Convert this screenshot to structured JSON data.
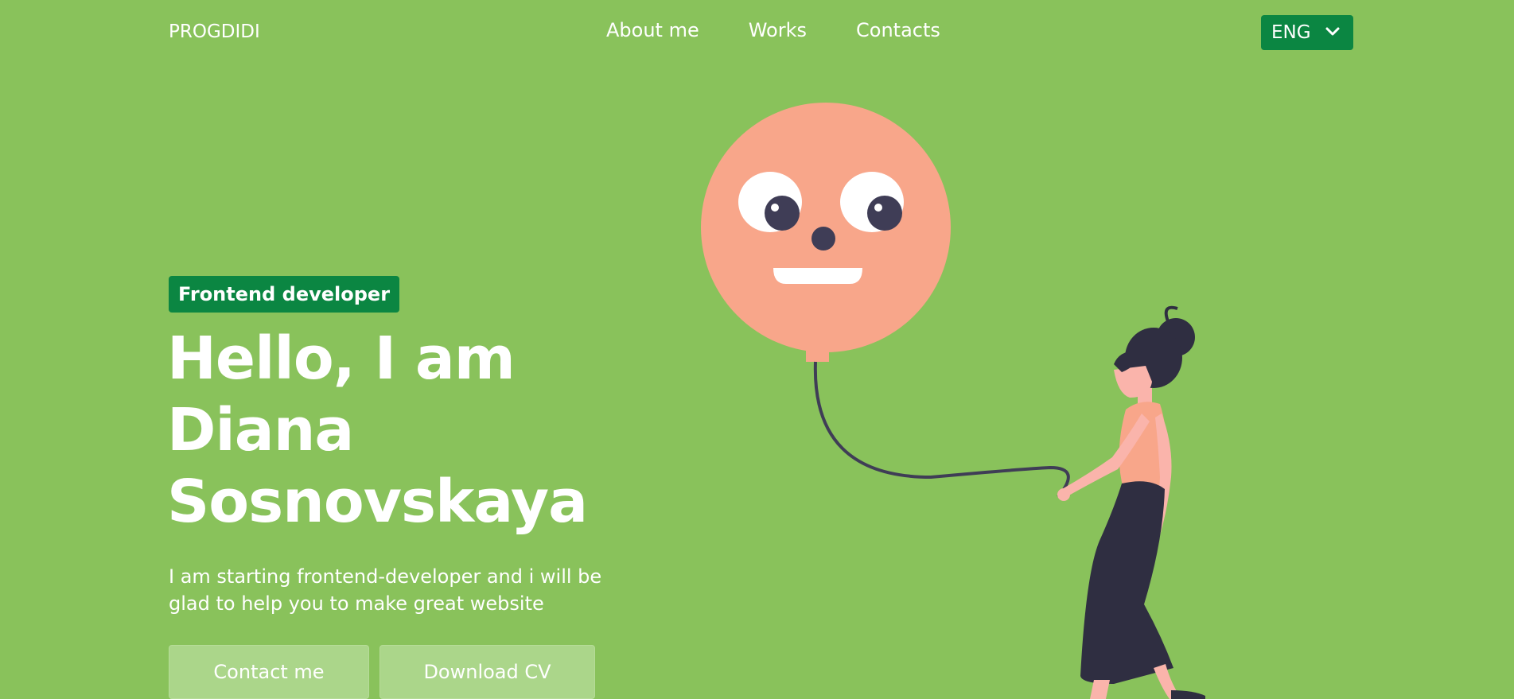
{
  "header": {
    "logo": "PROGDIDI",
    "nav": [
      "About me",
      "Works",
      "Contacts"
    ],
    "language": {
      "selected": "ENG",
      "icon": "chevron-down-icon"
    }
  },
  "hero": {
    "badge": "Frontend developer",
    "title_lines": [
      "Hello, I am",
      "Diana",
      "Sosnovskaya"
    ],
    "description": "I am starting frontend-developer and i will be glad to help you to make great website",
    "buttons": {
      "contact": "Contact me",
      "download": "Download CV"
    }
  },
  "colors": {
    "background": "#89c25b",
    "accent": "#0b8642",
    "button": "#abd68a",
    "balloon": "#f8a68a",
    "dark": "#2f2e41"
  }
}
